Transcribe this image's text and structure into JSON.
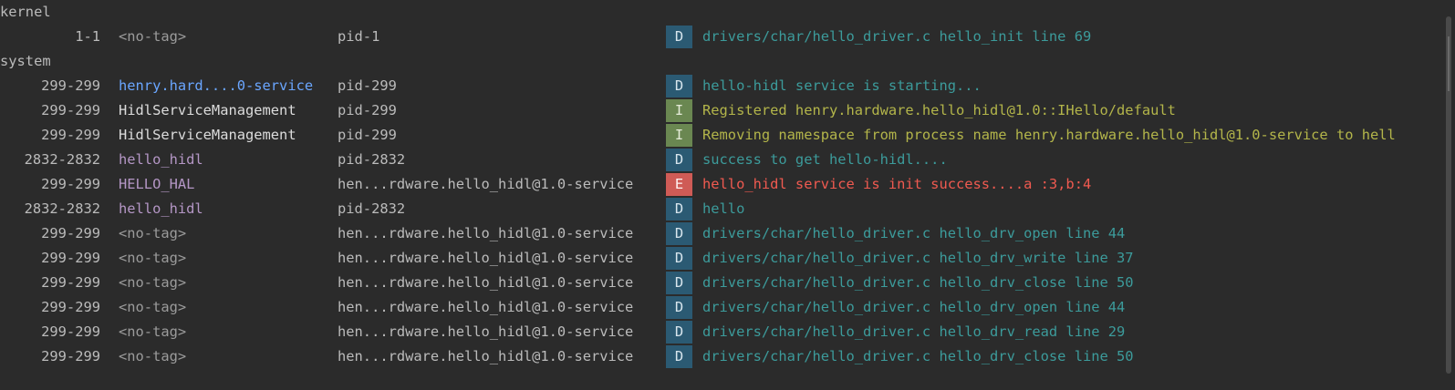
{
  "sections": [
    {
      "label": "kernel"
    },
    {
      "label": "system"
    }
  ],
  "rows": [
    {
      "pid": "1-1",
      "tag": "<no-tag>",
      "tag_color": "#9b9b9b",
      "proc": "pid-1",
      "level": "D",
      "msg": "drivers/char/hello_driver.c hello_init line 69",
      "msg_color": "#3c9b9b"
    },
    {
      "pid": "299-299",
      "tag": "henry.hard....0-service",
      "tag_color": "#6aa6ff",
      "proc": "pid-299",
      "level": "D",
      "msg": "hello-hidl service is starting...",
      "msg_color": "#3c9b9b"
    },
    {
      "pid": "299-299",
      "tag": "HidlServiceManagement",
      "tag_color": "#dcdcdc",
      "proc": "pid-299",
      "level": "I",
      "msg": "Registered henry.hardware.hello_hidl@1.0::IHello/default",
      "msg_color": "#b3b54a"
    },
    {
      "pid": "299-299",
      "tag": "HidlServiceManagement",
      "tag_color": "#dcdcdc",
      "proc": "pid-299",
      "level": "I",
      "msg": "Removing namespace from process name henry.hardware.hello_hidl@1.0-service to hell",
      "msg_color": "#b3b54a"
    },
    {
      "pid": "2832-2832",
      "tag": "hello_hidl",
      "tag_color": "#b597c6",
      "proc": "pid-2832",
      "level": "D",
      "msg": "success to get hello-hidl....",
      "msg_color": "#3c9b9b"
    },
    {
      "pid": "299-299",
      "tag": "HELLO_HAL",
      "tag_color": "#b597c6",
      "proc": "hen...rdware.hello_hidl@1.0-service",
      "level": "E",
      "msg": "hello_hidl service is init success....a :3,b:4",
      "msg_color": "#f05a50"
    },
    {
      "pid": "2832-2832",
      "tag": "hello_hidl",
      "tag_color": "#b597c6",
      "proc": "pid-2832",
      "level": "D",
      "msg": "hello",
      "msg_color": "#3c9b9b"
    },
    {
      "pid": "299-299",
      "tag": "<no-tag>",
      "tag_color": "#9b9b9b",
      "proc": "hen...rdware.hello_hidl@1.0-service",
      "level": "D",
      "msg": "drivers/char/hello_driver.c hello_drv_open line 44",
      "msg_color": "#3c9b9b"
    },
    {
      "pid": "299-299",
      "tag": "<no-tag>",
      "tag_color": "#9b9b9b",
      "proc": "hen...rdware.hello_hidl@1.0-service",
      "level": "D",
      "msg": "drivers/char/hello_driver.c hello_drv_write line 37",
      "msg_color": "#3c9b9b"
    },
    {
      "pid": "299-299",
      "tag": "<no-tag>",
      "tag_color": "#9b9b9b",
      "proc": "hen...rdware.hello_hidl@1.0-service",
      "level": "D",
      "msg": "drivers/char/hello_driver.c hello_drv_close line 50",
      "msg_color": "#3c9b9b"
    },
    {
      "pid": "299-299",
      "tag": "<no-tag>",
      "tag_color": "#9b9b9b",
      "proc": "hen...rdware.hello_hidl@1.0-service",
      "level": "D",
      "msg": "drivers/char/hello_driver.c hello_drv_open line 44",
      "msg_color": "#3c9b9b"
    },
    {
      "pid": "299-299",
      "tag": "<no-tag>",
      "tag_color": "#9b9b9b",
      "proc": "hen...rdware.hello_hidl@1.0-service",
      "level": "D",
      "msg": "drivers/char/hello_driver.c hello_drv_read line 29",
      "msg_color": "#3c9b9b"
    },
    {
      "pid": "299-299",
      "tag": "<no-tag>",
      "tag_color": "#9b9b9b",
      "proc": "hen...rdware.hello_hidl@1.0-service",
      "level": "D",
      "msg": "drivers/char/hello_driver.c hello_drv_close line 50",
      "msg_color": "#3c9b9b"
    }
  ]
}
